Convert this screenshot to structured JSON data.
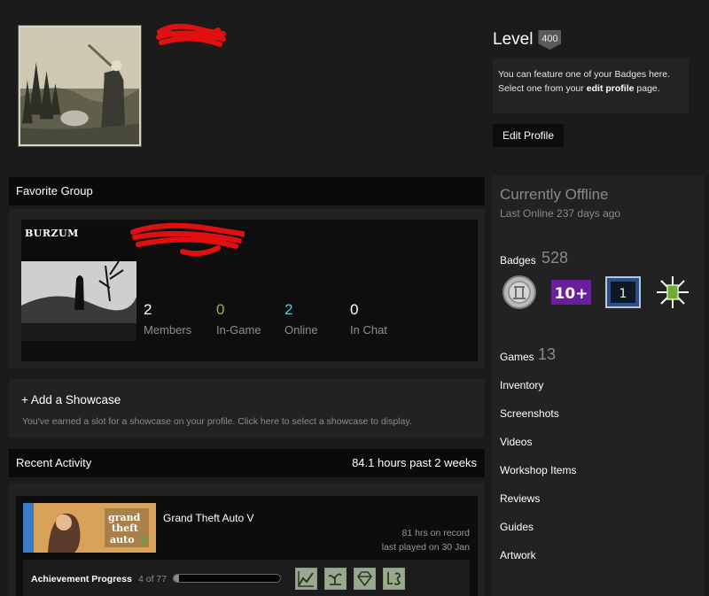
{
  "level": {
    "label": "Level",
    "value": "400"
  },
  "feature_box": {
    "line1": "You can feature one of your Badges here.",
    "line2_pre": "Select one from your ",
    "line2_link": "edit profile",
    "line2_post": " page."
  },
  "edit_profile_label": "Edit Profile",
  "favorite_group": {
    "header": "Favorite Group",
    "logo_text": "BURZUM",
    "stats": [
      {
        "num": "2",
        "label": "Members",
        "color": "#ffffff"
      },
      {
        "num": "0",
        "label": "In-Game",
        "color": "#8fb93b"
      },
      {
        "num": "2",
        "label": "Online",
        "color": "#57cbde"
      },
      {
        "num": "0",
        "label": "In Chat",
        "color": "#ffffff"
      }
    ]
  },
  "showcase": {
    "title": "+ Add a Showcase",
    "description": "You've earned a slot for a showcase on your profile. Click here to select a showcase to display."
  },
  "recent_activity": {
    "header": "Recent Activity",
    "hours": "84.1 hours past 2 weeks",
    "game": {
      "name": "Grand Theft Auto V",
      "hours_on_record": "81 hrs on record",
      "last_played": "last played on 30 Jan"
    },
    "achievements": {
      "label": "Achievement Progress",
      "count": "4 of 77",
      "progress": 0.052
    }
  },
  "status": {
    "title": "Currently Offline",
    "last_online": "Last Online 237 days ago"
  },
  "badges": {
    "label": "Badges",
    "count": "528",
    "items": [
      "silver-coin-badge-icon",
      "10+",
      "1",
      "sparkle-gem-badge-icon"
    ]
  },
  "games": {
    "label": "Games",
    "count": "13"
  },
  "links": [
    "Inventory",
    "Screenshots",
    "Videos",
    "Workshop Items",
    "Reviews",
    "Guides",
    "Artwork"
  ],
  "colors": {
    "background": "#1b1b1b",
    "panel": "#222222",
    "header_bar": "#0a0a0a",
    "in_game": "#8fb93b",
    "online": "#57cbde",
    "redaction": "#e01010"
  }
}
